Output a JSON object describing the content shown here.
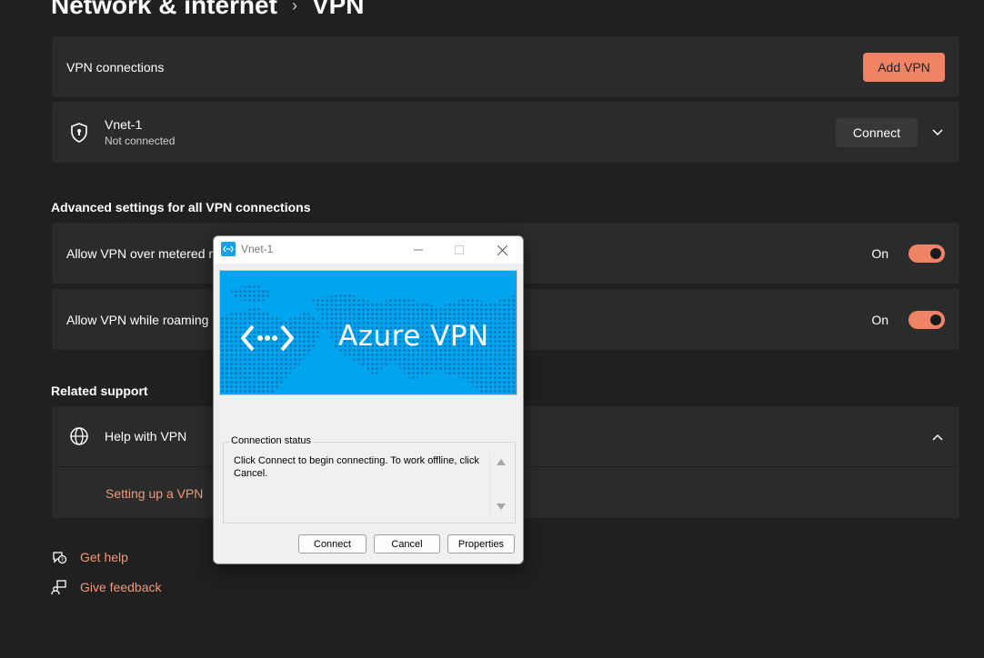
{
  "header": {
    "breadcrumb_parent": "Network & internet",
    "breadcrumb_current": "VPN"
  },
  "vpn_connections": {
    "label": "VPN connections",
    "add_button": "Add VPN"
  },
  "connection": {
    "name": "Vnet-1",
    "status": "Not connected",
    "connect_button": "Connect"
  },
  "advanced": {
    "title": "Advanced settings for all VPN connections",
    "settings": [
      {
        "label": "Allow VPN over metered networks",
        "state": "On",
        "enabled": true
      },
      {
        "label": "Allow VPN while roaming",
        "state": "On",
        "enabled": true
      }
    ]
  },
  "related": {
    "title": "Related support",
    "help_label": "Help with VPN",
    "link": "Setting up a VPN"
  },
  "footer": {
    "get_help": "Get help",
    "give_feedback": "Give feedback"
  },
  "dialog": {
    "title": "Vnet-1",
    "banner_text": "Azure VPN",
    "group_label": "Connection status",
    "status_text": "Click Connect to begin connecting.  To work offline, click Cancel.",
    "buttons": {
      "connect": "Connect",
      "cancel": "Cancel",
      "properties": "Properties"
    }
  },
  "colors": {
    "accent": "#f08365",
    "background": "#202020",
    "card": "#2b2b2b",
    "banner": "#00a4ef"
  }
}
